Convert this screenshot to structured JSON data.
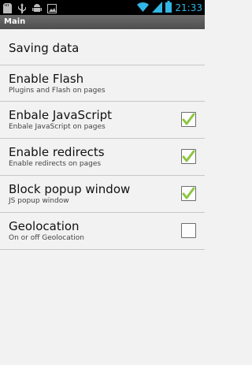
{
  "statusbar": {
    "time": "21:33",
    "left_icons": [
      "sdcard-icon",
      "usb-icon",
      "android-debug-icon",
      "image-icon"
    ],
    "right_icons": [
      "wifi-icon",
      "signal-icon",
      "battery-icon"
    ],
    "time_color": "#33b5e5"
  },
  "titlebar": {
    "title": "Main"
  },
  "settings": [
    {
      "title": "Saving data",
      "subtitle": "",
      "has_checkbox": false,
      "checked": false
    },
    {
      "title": "Enable Flash",
      "subtitle": "Plugins and Flash on pages",
      "has_checkbox": false,
      "checked": false
    },
    {
      "title": "Enbale JavaScript",
      "subtitle": "Enbale JavaScript on pages",
      "has_checkbox": true,
      "checked": true
    },
    {
      "title": "Enable redirects",
      "subtitle": "Enable redirects on pages",
      "has_checkbox": true,
      "checked": true
    },
    {
      "title": "Block popup window",
      "subtitle": "JS popup window",
      "has_checkbox": true,
      "checked": true
    },
    {
      "title": "Geolocation",
      "subtitle": "On or off Geolocation",
      "has_checkbox": true,
      "checked": false
    }
  ],
  "colors": {
    "check": "#8cc63f",
    "background": "#f2f2f2",
    "divider": "#c7c7c7"
  }
}
